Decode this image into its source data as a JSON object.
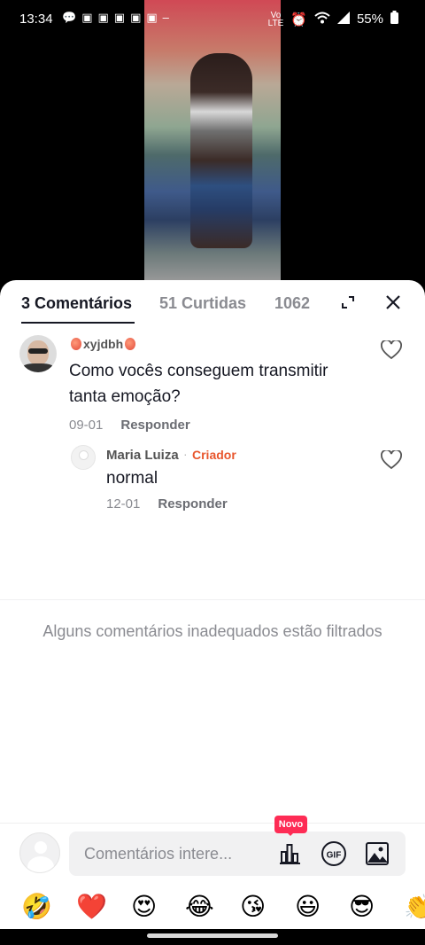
{
  "status_bar": {
    "time": "13:34",
    "battery": "55%",
    "icons": [
      "chat-bubble-icon",
      "app-notification-icon",
      "wifi-icon",
      "signal-icon",
      "alarm-icon",
      "volte-icon",
      "battery-icon"
    ]
  },
  "tabs": {
    "comments": "3 Comentários",
    "likes": "51 Curtidas",
    "views": "1062 "
  },
  "comments": [
    {
      "username": "xyjdbh",
      "text": "Como vocês conseguem transmitir tanta emoção?",
      "date": "09-01",
      "reply": "Responder"
    },
    {
      "username": "Maria Luiza",
      "dot": "·",
      "badge": "Criador",
      "text": "normal",
      "date": "12-01",
      "reply": "Responder"
    }
  ],
  "filtered_notice": "Alguns comentários inadequados estão filtrados",
  "input": {
    "placeholder": "Comentários intere...",
    "new_badge": "Novo",
    "gif_label": "GIF"
  },
  "emojis": [
    "🤣",
    "❤️",
    "😍",
    "😂",
    "😘",
    "😃",
    "😎",
    "👏"
  ],
  "colors": {
    "accent": "#fe2c55",
    "creator": "#e8562d",
    "text": "#161823",
    "muted": "#8a8b91"
  }
}
